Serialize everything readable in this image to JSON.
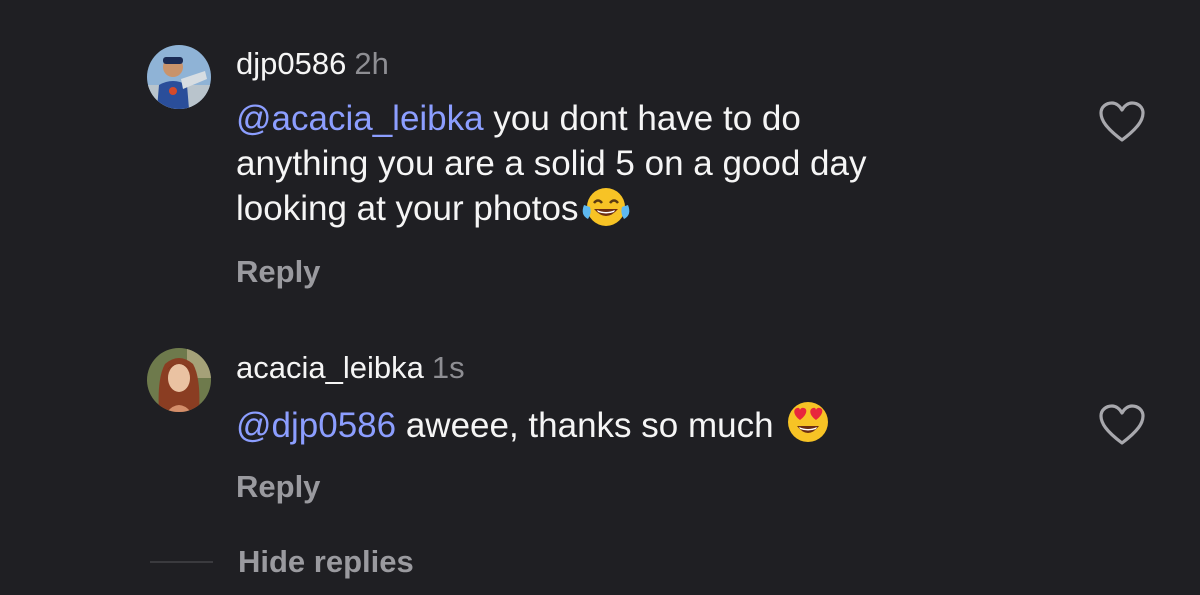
{
  "comments": [
    {
      "username": "djp0586",
      "time": "2h",
      "mention": "@acacia_leibka",
      "text_line1": " you dont have to do",
      "text_line2": "anything you are a solid 5 on a good day",
      "text_line3": "looking at your photos",
      "emoji": "tears-of-joy-emoji",
      "reply_label": "Reply",
      "liked": false
    },
    {
      "username": "acacia_leibka",
      "time": "1s",
      "mention": "@djp0586",
      "text_line1": " aweee, thanks so much ",
      "emoji": "heart-eyes-emoji",
      "reply_label": "Reply",
      "liked": false
    }
  ],
  "hide_replies_label": "Hide replies",
  "colors": {
    "background": "#1f1f23",
    "mention": "#8c9eff",
    "muted": "#9a9a9f"
  }
}
